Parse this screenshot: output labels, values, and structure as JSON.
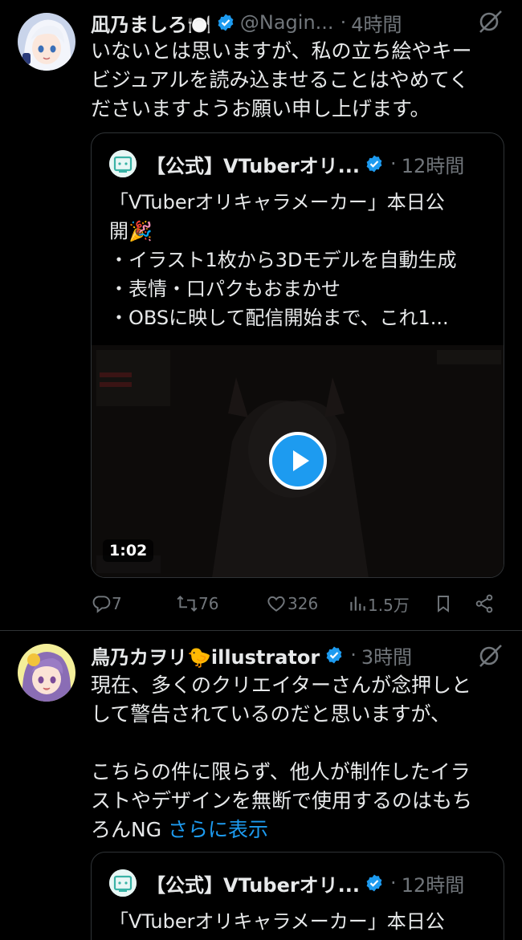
{
  "tweets": [
    {
      "name": "凪乃ましろ🍽️",
      "handle": "@Nagin...",
      "dot": "·",
      "time": "4時間",
      "text": "いないとは思いますが、私の立ち絵やキー\nビジュアルを読み込ませることはやめてく\nださいますようお願い申し上げます。",
      "quote": {
        "name": "【公式】VTuberオリ...",
        "dot": "·",
        "time": "12時間",
        "text": "「VTuberオリキャラメーカー」本日公\n開🎉\n・イラスト1枚から3Dモデルを自動生成\n・表情・口パクもおまかせ\n・OBSに映して配信開始まで、これ1...",
        "video_duration": "1:02"
      },
      "actions": {
        "replies": "7",
        "reposts": "76",
        "likes": "326",
        "views": "1.5万"
      }
    },
    {
      "name": "鳥乃カヲリ🐤illustrator",
      "dot": "·",
      "time": "3時間",
      "text": "現在、多くのクリエイターさんが念押しと\nして警告されているのだと思いますが、\n\nこちらの件に限らず、他人が制作したイラ\nストやデザインを無断で使用するのはもち\nろんNG ",
      "more": "さらに表示",
      "quote": {
        "name": "【公式】VTuberオリ...",
        "dot": "·",
        "time": "12時間",
        "text": "「VTuberオリキャラメーカー」本日公"
      }
    }
  ],
  "colors": {
    "background": "#000000",
    "text": "#e7e9ea",
    "muted": "#71767b",
    "accent": "#1d9bf0",
    "border": "#2f3336"
  },
  "icons": [
    "verified-badge-icon",
    "grok-icon",
    "reply-icon",
    "repost-icon",
    "like-icon",
    "views-icon",
    "bookmark-icon",
    "share-icon",
    "play-icon"
  ]
}
